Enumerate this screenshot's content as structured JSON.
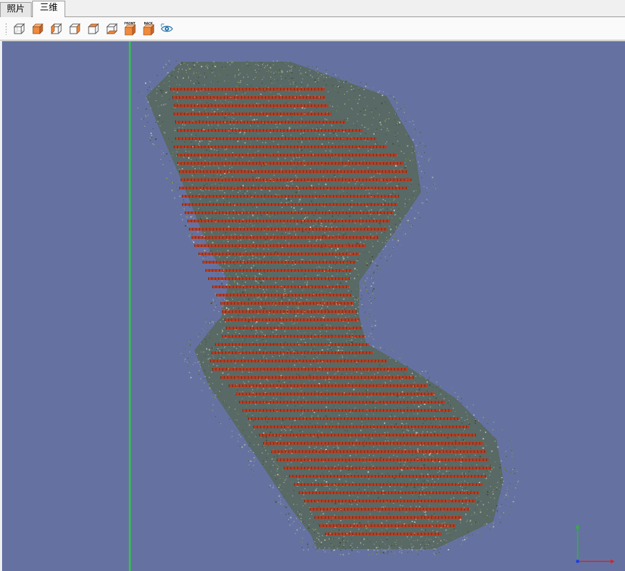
{
  "tabs": [
    {
      "label": "照片",
      "active": false
    },
    {
      "label": "三维",
      "active": true
    }
  ],
  "toolbar": {
    "buttons": [
      {
        "icon": "cube-wireframe-icon",
        "badge": ""
      },
      {
        "icon": "cube-solid-icon",
        "badge": ""
      },
      {
        "icon": "cube-left-view-icon",
        "badge": ""
      },
      {
        "icon": "cube-right-view-icon",
        "badge": ""
      },
      {
        "icon": "cube-top-view-icon",
        "badge": ""
      },
      {
        "icon": "cube-bottom-view-icon",
        "badge": ""
      },
      {
        "icon": "front-view-icon",
        "badge": "FRONT"
      },
      {
        "icon": "back-view-icon",
        "badge": "BACK"
      },
      {
        "icon": "camera-visibility-icon",
        "badge": ""
      }
    ]
  },
  "viewport": {
    "background_color": "#6572a1",
    "axis_line_color": "#2ecc40",
    "point_cloud_colors": [
      "#5a6e3a",
      "#6b7d45",
      "#8a9560",
      "#c9c9c0",
      "#3c4a2c",
      "#b8b8a8"
    ],
    "camera_marker_color": "#c0391b",
    "axis_gizmo": {
      "x_color": "#e02020",
      "y_color": "#20c020",
      "z_color": "#2040e0"
    }
  }
}
